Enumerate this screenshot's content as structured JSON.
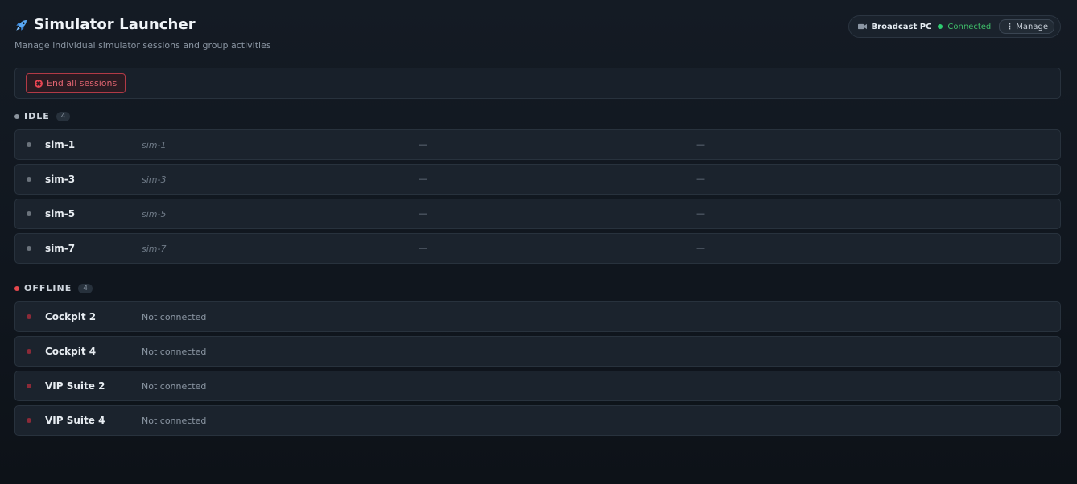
{
  "header": {
    "title": "Simulator Launcher",
    "subtitle": "Manage individual simulator sessions and group activities",
    "icon": "rocket-icon"
  },
  "broadcast": {
    "label": "Broadcast PC",
    "status": "Connected",
    "manage_label": "Manage",
    "status_color": "#2ecc71"
  },
  "toolbar": {
    "end_all_label": "End all sessions"
  },
  "sections": {
    "idle": {
      "label": "IDLE",
      "count": "4",
      "dot_color": "#8b949e",
      "rows": [
        {
          "name": "sim-1",
          "id": "sim-1",
          "col3": "—",
          "col4": "—"
        },
        {
          "name": "sim-3",
          "id": "sim-3",
          "col3": "—",
          "col4": "—"
        },
        {
          "name": "sim-5",
          "id": "sim-5",
          "col3": "—",
          "col4": "—"
        },
        {
          "name": "sim-7",
          "id": "sim-7",
          "col3": "—",
          "col4": "—"
        }
      ]
    },
    "offline": {
      "label": "OFFLINE",
      "count": "4",
      "dot_color": "#e5484d",
      "row_dot_color": "#8c2a38",
      "rows": [
        {
          "name": "Cockpit 2",
          "status": "Not connected"
        },
        {
          "name": "Cockpit 4",
          "status": "Not connected"
        },
        {
          "name": "VIP Suite 2",
          "status": "Not connected"
        },
        {
          "name": "VIP Suite 4",
          "status": "Not connected"
        }
      ]
    }
  },
  "colors": {
    "accent_danger": "#e84552",
    "connected_green": "#2ecc71",
    "rocket_blue": "#5aa9f5"
  }
}
